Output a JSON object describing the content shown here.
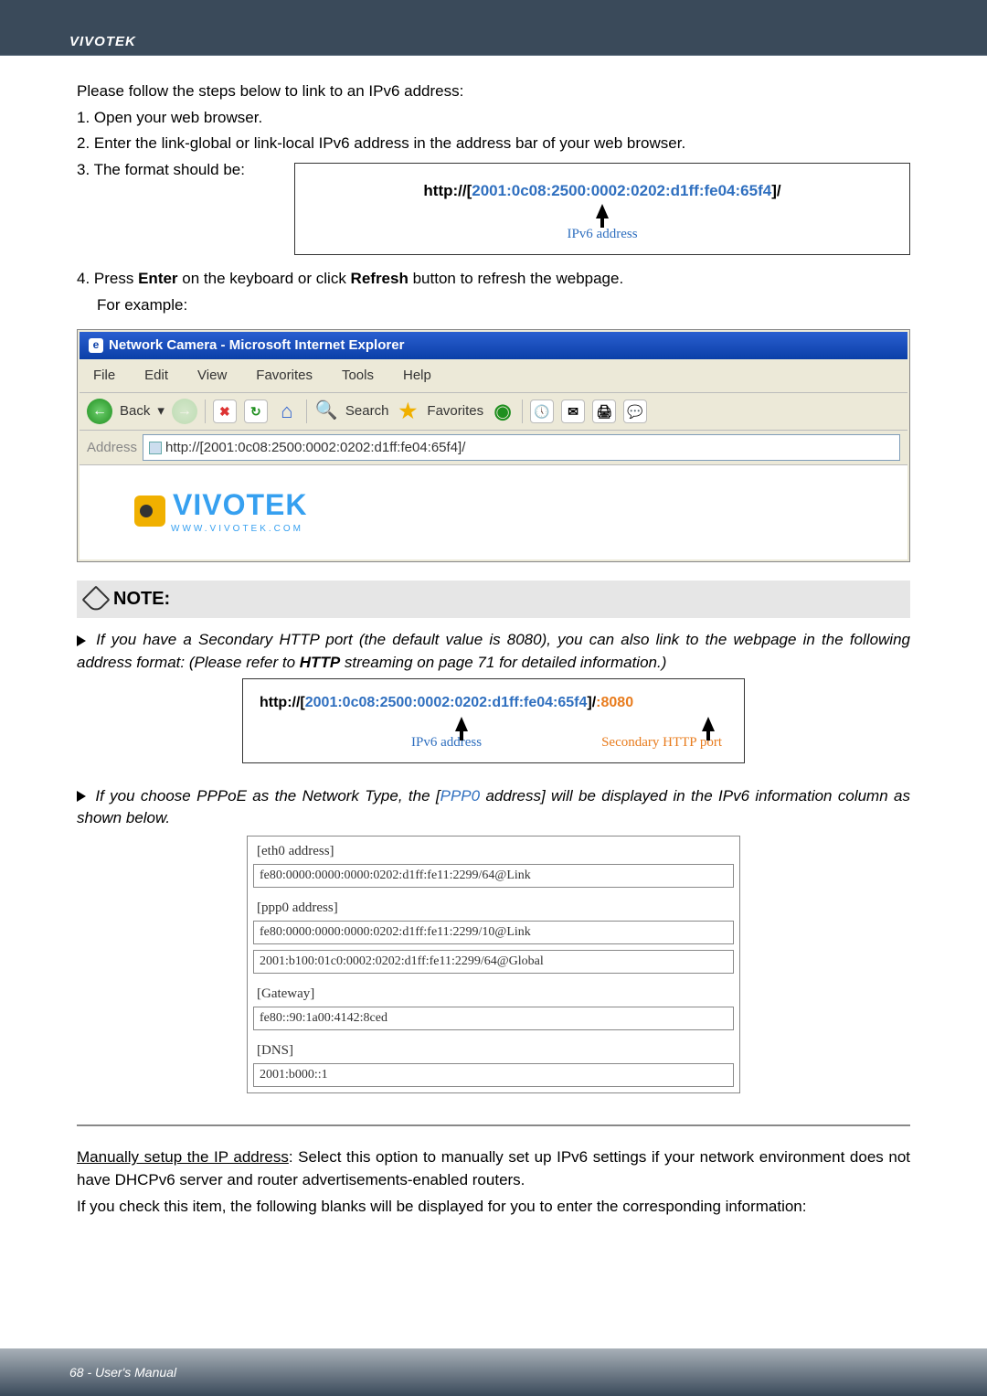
{
  "header": {
    "brand": "VIVOTEK"
  },
  "intro": {
    "lead": "Please follow the steps below to link to an IPv6 address:",
    "s1": "1. Open your web browser.",
    "s2": "2. Enter the link-global or link-local IPv6 address in the address bar of your web browser.",
    "s3": "3. The format should be:"
  },
  "url1": {
    "prefix": "http://[",
    "ipv6": "2001:0c08:2500:0002:0202:d1ff:fe04:65f4",
    "suffix": "]/",
    "caption": "IPv6 address"
  },
  "step4": {
    "line": "4. Press Enter on the keyboard or click Refresh button to refresh the webpage.",
    "example": "For example:",
    "enter": "Enter",
    "refresh": "Refresh"
  },
  "ie": {
    "title": "Network Camera - Microsoft Internet Explorer",
    "menu": {
      "file": "File",
      "edit": "Edit",
      "view": "View",
      "favorites": "Favorites",
      "tools": "Tools",
      "help": "Help"
    },
    "back": "Back",
    "search": "Search",
    "favLabel": "Favorites",
    "addrLabel": "Address",
    "addrValue": "http://[2001:0c08:2500:0002:0202:d1ff:fe04:65f4]/",
    "logoText": "VIVOTEK",
    "logoSub": "WWW.VIVOTEK.COM"
  },
  "note": {
    "heading": "NOTE:",
    "p1a": "If you have a Secondary HTTP port (the default value is 8080), you can also link to the webpage in the following address format: (Please refer to ",
    "p1b": "HTTP",
    "p1c": " streaming on page 71 for detailed information.)",
    "p2a": "If you choose PPPoE as the Network Type, the [",
    "p2b": "PPP0",
    "p2c": " address] will be displayed in the IPv6 information column as shown below."
  },
  "url2": {
    "prefix": "http://[",
    "ipv6": "2001:0c08:2500:0002:0202:d1ff:fe04:65f4",
    "mid": "]/",
    "port": ":8080",
    "cap1": "IPv6 address",
    "cap2": "Secondary HTTP port"
  },
  "pppoe": {
    "eth_label": "[eth0 address]",
    "eth_val": "fe80:0000:0000:0000:0202:d1ff:fe11:2299/64@Link",
    "ppp_label": "[ppp0 address]",
    "ppp_val1": "fe80:0000:0000:0000:0202:d1ff:fe11:2299/10@Link",
    "ppp_val2": "2001:b100:01c0:0002:0202:d1ff:fe11:2299/64@Global",
    "gw_label": "[Gateway]",
    "gw_val": "fe80::90:1a00:4142:8ced",
    "dns_label": "[DNS]",
    "dns_val": "2001:b000::1"
  },
  "manual": {
    "t1a": "Manually setup the IP address",
    "t1b": ": Select this option to manually set up IPv6 settings if your network environment does not have DHCPv6 server and router advertisements-enabled routers.",
    "t2": "If you check this item, the following blanks will be displayed for you to enter the corresponding information:"
  },
  "footer": {
    "page": "68 - User's Manual"
  }
}
